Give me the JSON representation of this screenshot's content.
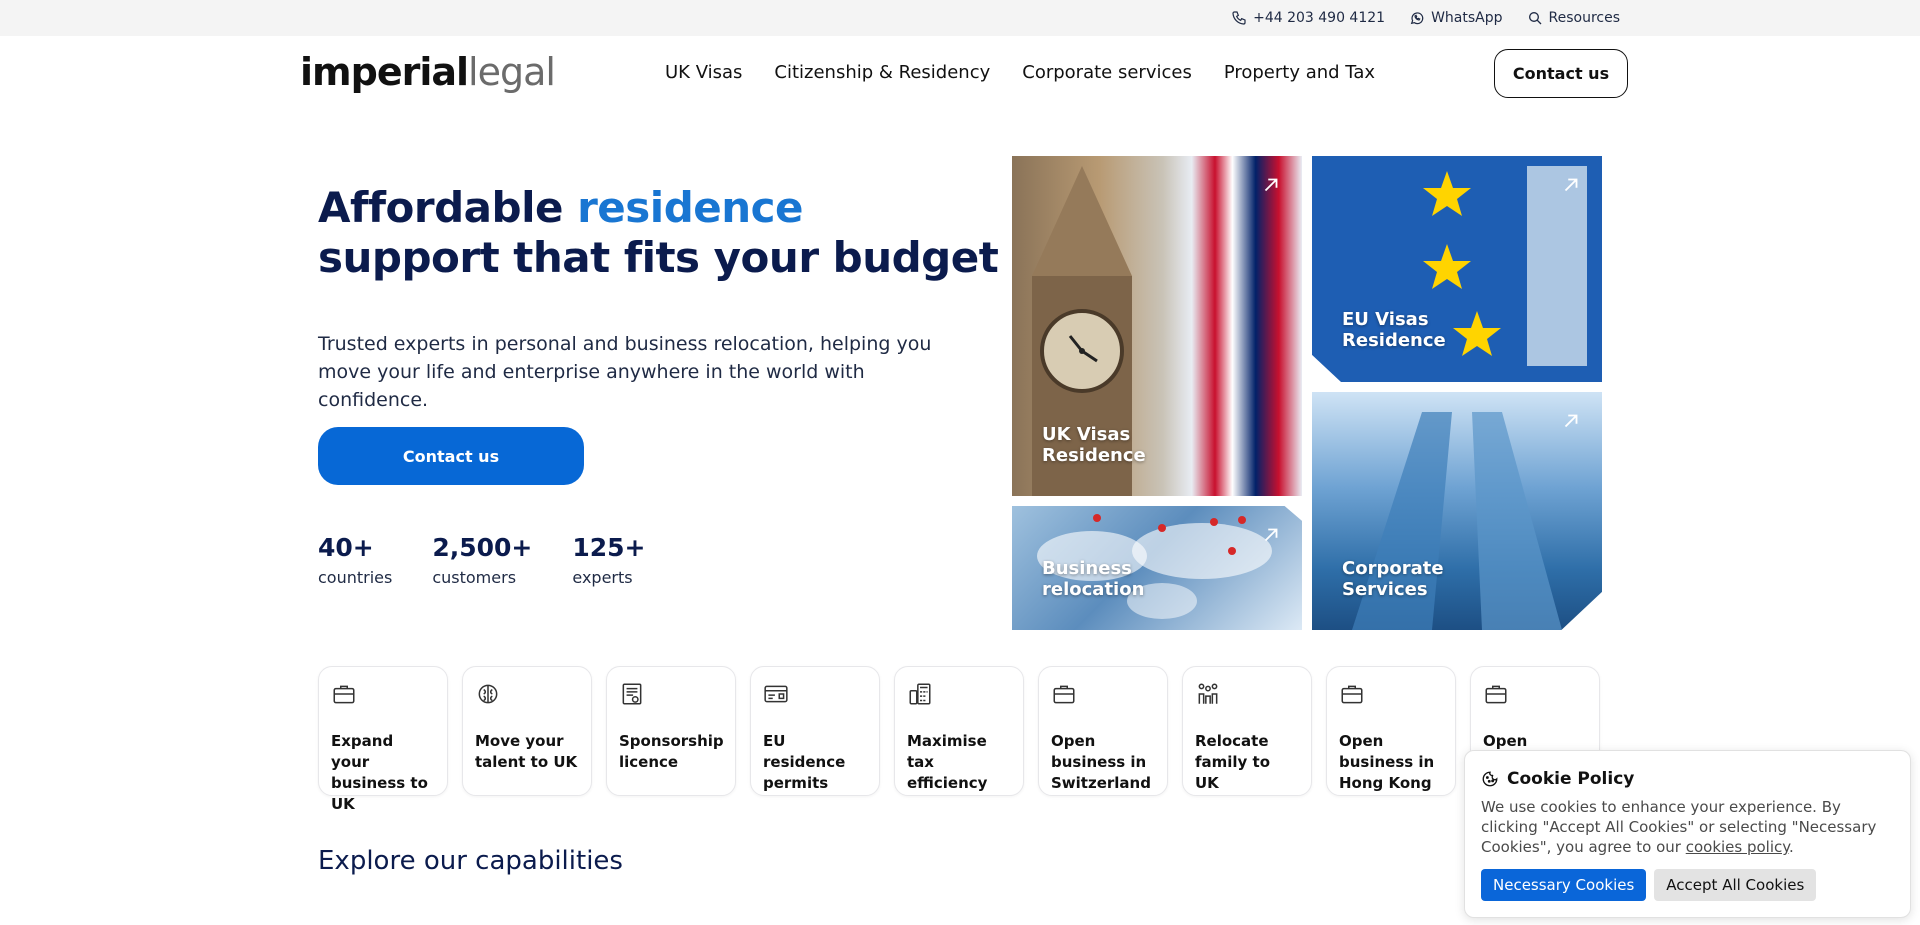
{
  "topbar": {
    "phone": "+44 203 490 4121",
    "whatsapp": "WhatsApp",
    "resources": "Resources"
  },
  "header": {
    "logo_bold": "imperial",
    "logo_light": "legal",
    "nav": [
      "UK Visas",
      "Citizenship & Residency",
      "Corporate services",
      "Property and Tax"
    ],
    "contact_label": "Contact us"
  },
  "hero": {
    "title_part1": "Affordable ",
    "title_accent": "residence",
    "title_part2": "support that fits your budget",
    "text": "Trusted experts in personal and business relocation, helping you move your life and enterprise anywhere in the world with confidence.",
    "cta_label": "Contact us"
  },
  "stats": [
    {
      "value": "40+",
      "label": "countries"
    },
    {
      "value": "2,500+",
      "label": "customers"
    },
    {
      "value": "125+",
      "label": "experts"
    }
  ],
  "tiles": {
    "uk": "UK Visas\nResidence",
    "eu": "EU Visas\nResidence",
    "business": "Business\nrelocation",
    "corporate": "Corporate\nServices"
  },
  "cards": [
    {
      "title": "Expand your business to UK",
      "icon": "briefcase-icon"
    },
    {
      "title": "Move your talent to UK",
      "icon": "brain-icon"
    },
    {
      "title": "Sponsorship licence",
      "icon": "certificate-icon"
    },
    {
      "title": "EU residence permits",
      "icon": "id-card-icon"
    },
    {
      "title": "Maximise tax efficiency",
      "icon": "calculator-icon"
    },
    {
      "title": "Open business in Switzerland",
      "icon": "briefcase-icon"
    },
    {
      "title": "Relocate family to UK",
      "icon": "family-icon"
    },
    {
      "title": "Open business in Hong Kong",
      "icon": "briefcase-icon"
    },
    {
      "title": "Open",
      "icon": "briefcase-icon"
    }
  ],
  "explore_title": "Explore our capabilities",
  "cookie": {
    "title": "Cookie Policy",
    "text": "We use cookies to enhance your experience. By clicking \"Accept All Cookies\" or selecting \"Necessary Cookies\", you agree to our ",
    "link": "cookies policy",
    "text_end": ".",
    "necessary_label": "Necessary Cookies",
    "accept_label": "Accept All Cookies"
  },
  "colors": {
    "primary_blue": "#0768d6",
    "accent_blue": "#1976d2",
    "navy": "#0b1b4d"
  }
}
